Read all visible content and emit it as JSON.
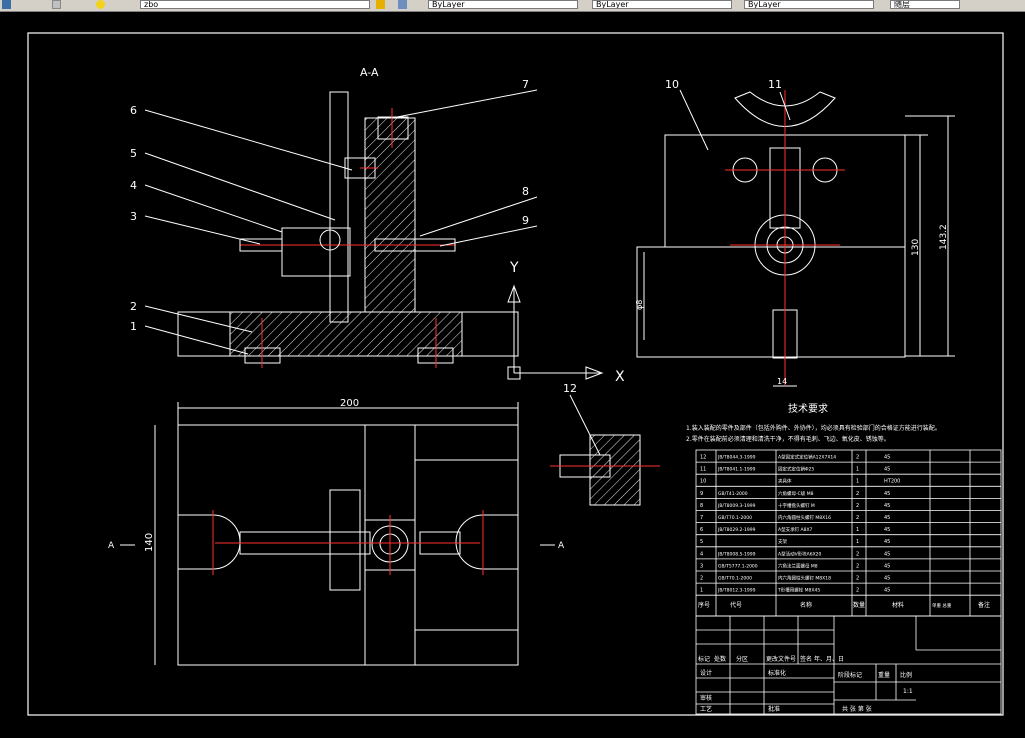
{
  "toolbar": {
    "layer_value": "zbo",
    "linetype_value": "ByLayer",
    "lineweight_value": "ByLayer",
    "color_value": "ByLayer",
    "style_value": "随层"
  },
  "drawing": {
    "section_label": "A-A",
    "callouts": [
      "1",
      "2",
      "3",
      "4",
      "5",
      "6",
      "7",
      "8",
      "9",
      "10",
      "11",
      "12"
    ],
    "dim_width": "200",
    "dim_height": "140",
    "dim_130": "130",
    "dim_143": "143.2",
    "dim_14": "14",
    "dim_phi": "φ8",
    "ucs_y": "Y",
    "ucs_x": "X",
    "section_mark_left": "A",
    "section_mark_right": "A"
  },
  "tech": {
    "title": "技术要求",
    "line1": "1.装入装配的零件及部件（包括外购件、外协件），均必须具有检验部门的合格证方能进行装配。",
    "line2": "2.零件在装配前必须清理和清洗干净，不得有毛刺、飞边、氧化皮、锈蚀等。"
  },
  "bom": {
    "rows": [
      {
        "no": "12",
        "code": "JB/T8044.3-1999",
        "name": "A型固定式定位销A12X7X14",
        "qty": "2",
        "mat": "45"
      },
      {
        "no": "11",
        "code": "JB/T8041.1-1999",
        "name": "固定式定位销Φ25",
        "qty": "1",
        "mat": "45"
      },
      {
        "no": "10",
        "code": "",
        "name": "夹具体",
        "qty": "1",
        "mat": "HT200"
      },
      {
        "no": "9",
        "code": "GB/T41-2000",
        "name": "六角螺母-C级 M8",
        "qty": "2",
        "mat": "45"
      },
      {
        "no": "8",
        "code": "JB/T8009.3-1999",
        "name": "十字槽盘头螺钉 M",
        "qty": "2",
        "mat": "45"
      },
      {
        "no": "7",
        "code": "GB/T70.1-2000",
        "name": "内六角圆柱头螺钉 M8X16",
        "qty": "2",
        "mat": "45"
      },
      {
        "no": "6",
        "code": "JB/T8029.2-1999",
        "name": "A型支承钉 A8X7",
        "qty": "1",
        "mat": "45"
      },
      {
        "no": "5",
        "code": "",
        "name": "支架",
        "qty": "1",
        "mat": "45"
      },
      {
        "no": "4",
        "code": "JB/T8008.5-1999",
        "name": "A型活动V形块A6X20",
        "qty": "2",
        "mat": "45"
      },
      {
        "no": "3",
        "code": "GB/T5777.1-2000",
        "name": "六角法兰面螺母 M8",
        "qty": "2",
        "mat": "45"
      },
      {
        "no": "2",
        "code": "GB/T70.1-2000",
        "name": "内六角圆柱头螺钉 M8X18",
        "qty": "2",
        "mat": "45"
      },
      {
        "no": "1",
        "code": "JB/T8012.3-1999",
        "name": "T形槽用螺栓 M8X45",
        "qty": "2",
        "mat": "45"
      }
    ],
    "header": {
      "no": "序号",
      "code": "代号",
      "name": "名称",
      "qty": "数量",
      "mat": "材料",
      "weight": "单重 总重",
      "note": "备注"
    }
  },
  "title_block": {
    "row1": [
      "标记",
      "处数",
      "分区",
      "更改文件号",
      "签名",
      "年、月、日"
    ],
    "design": "设计",
    "standard": "标准化",
    "check": "审核",
    "process": "工艺",
    "approve": "批准",
    "stage": "阶段标记",
    "weight": "重量",
    "scale": "比例",
    "scale_value": "1:1",
    "sheets": "共  张  第  张"
  }
}
